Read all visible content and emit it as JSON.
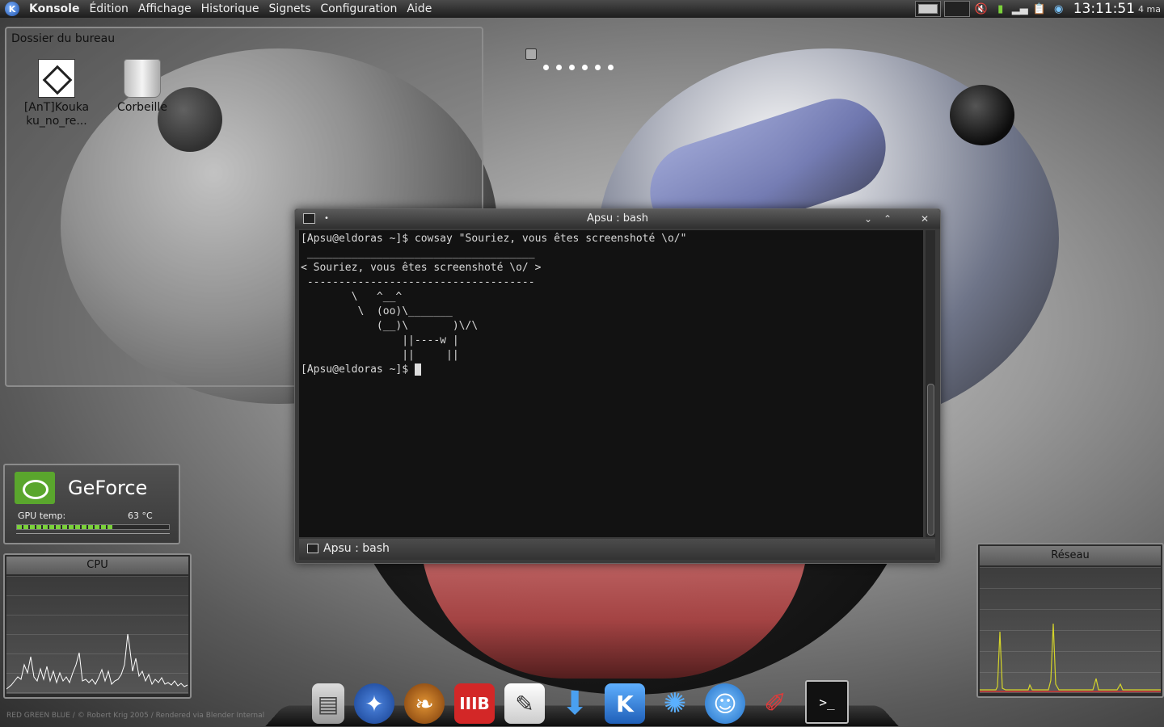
{
  "topbar": {
    "menus": [
      "Konsole",
      "Édition",
      "Affichage",
      "Historique",
      "Signets",
      "Configuration",
      "Aide"
    ],
    "clock": "13:11:51",
    "date": "4 ma"
  },
  "desktop": {
    "folder_title": "Dossier du bureau",
    "icons": [
      {
        "label_line1": "[AnT]Kouka",
        "label_line2": "ku_no_re...",
        "icon": "video-file-icon"
      },
      {
        "label_line1": "Corbeille",
        "label_line2": "",
        "icon": "trash-icon"
      }
    ],
    "credit": "RED GREEN BLUE / © Robert Krig 2005 / Rendered via Blender Internal"
  },
  "geforce": {
    "title": "GeForce",
    "temp_label": "GPU temp:",
    "temp_value": "63 °C",
    "temp_fraction": 0.63
  },
  "cpu": {
    "title": "CPU"
  },
  "network": {
    "title": "Réseau"
  },
  "konsole": {
    "title": "Apsu : bash",
    "tab_label": "Apsu : bash",
    "lines": [
      "[Apsu@eldoras ~]$ cowsay \"Souriez, vous êtes screenshoté \\o/\"",
      " ____________________________________",
      "< Souriez, vous êtes screenshoté \\o/ >",
      " ------------------------------------",
      "        \\   ^__^",
      "         \\  (oo)\\_______",
      "            (__)\\       )\\/\\",
      "                ||----w |",
      "                ||     ||"
    ],
    "prompt": "[Apsu@eldoras ~]$ "
  },
  "colors": {
    "nvidia_green": "#5aa62d",
    "cpu_graph": "#ffffff",
    "net_graph": "#d4d42a"
  }
}
